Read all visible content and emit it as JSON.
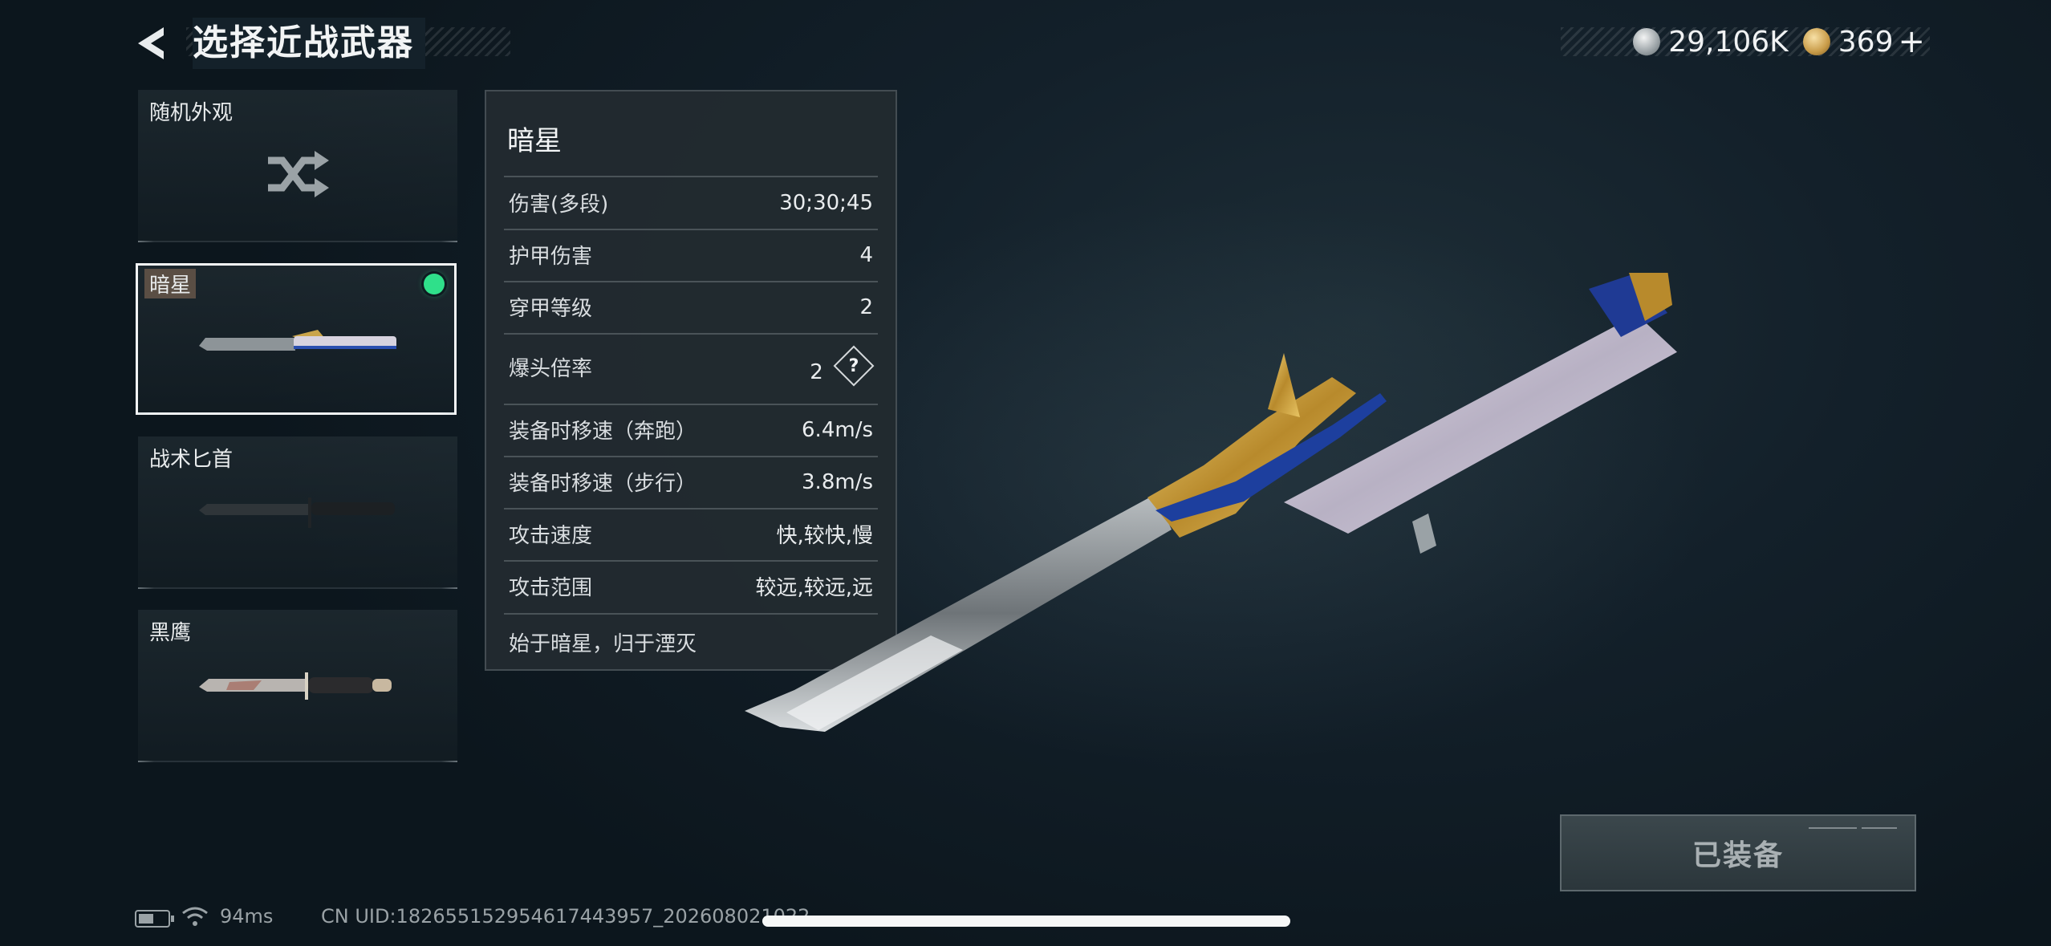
{
  "header": {
    "back_icon": "back-arrow-icon",
    "title": "选择近战武器"
  },
  "currency": {
    "silver": {
      "icon": "silver-coin-icon",
      "amount": "29,106K"
    },
    "gold": {
      "icon": "gold-coin-icon",
      "amount": "369"
    },
    "plus_label": "+"
  },
  "weapon_list": {
    "items": [
      {
        "label": "随机外观",
        "icon": "shuffle-icon"
      },
      {
        "label": "暗星",
        "selected": true,
        "equipped": true
      },
      {
        "label": "战术匕首"
      },
      {
        "label": "黑鹰"
      }
    ]
  },
  "detail": {
    "name": "暗星",
    "stats": [
      {
        "label": "伤害(多段)",
        "value": "30;30;45"
      },
      {
        "label": "护甲伤害",
        "value": "4"
      },
      {
        "label": "穿甲等级",
        "value": "2"
      },
      {
        "label": "爆头倍率",
        "value": "2",
        "help_icon": "question-icon",
        "help_label": "?"
      },
      {
        "label": "装备时移速（奔跑）",
        "value": "6.4m/s"
      },
      {
        "label": "装备时移速（步行）",
        "value": "3.8m/s"
      },
      {
        "label": "攻击速度",
        "value": "快,较快,慢"
      },
      {
        "label": "攻击范围",
        "value": "较远,较远,远"
      }
    ],
    "description": "始于暗星，归于湮灭"
  },
  "equip_button": {
    "label": "已装备"
  },
  "footer": {
    "battery_icon": "battery-icon",
    "wifi_icon": "wifi-icon",
    "ping": "94ms",
    "uid": "CN UID:1826551529546174439​57_202608021022"
  },
  "colors": {
    "equipped_dot": "#2fe08a",
    "background": "#13202a",
    "panel": "#222a2f"
  }
}
